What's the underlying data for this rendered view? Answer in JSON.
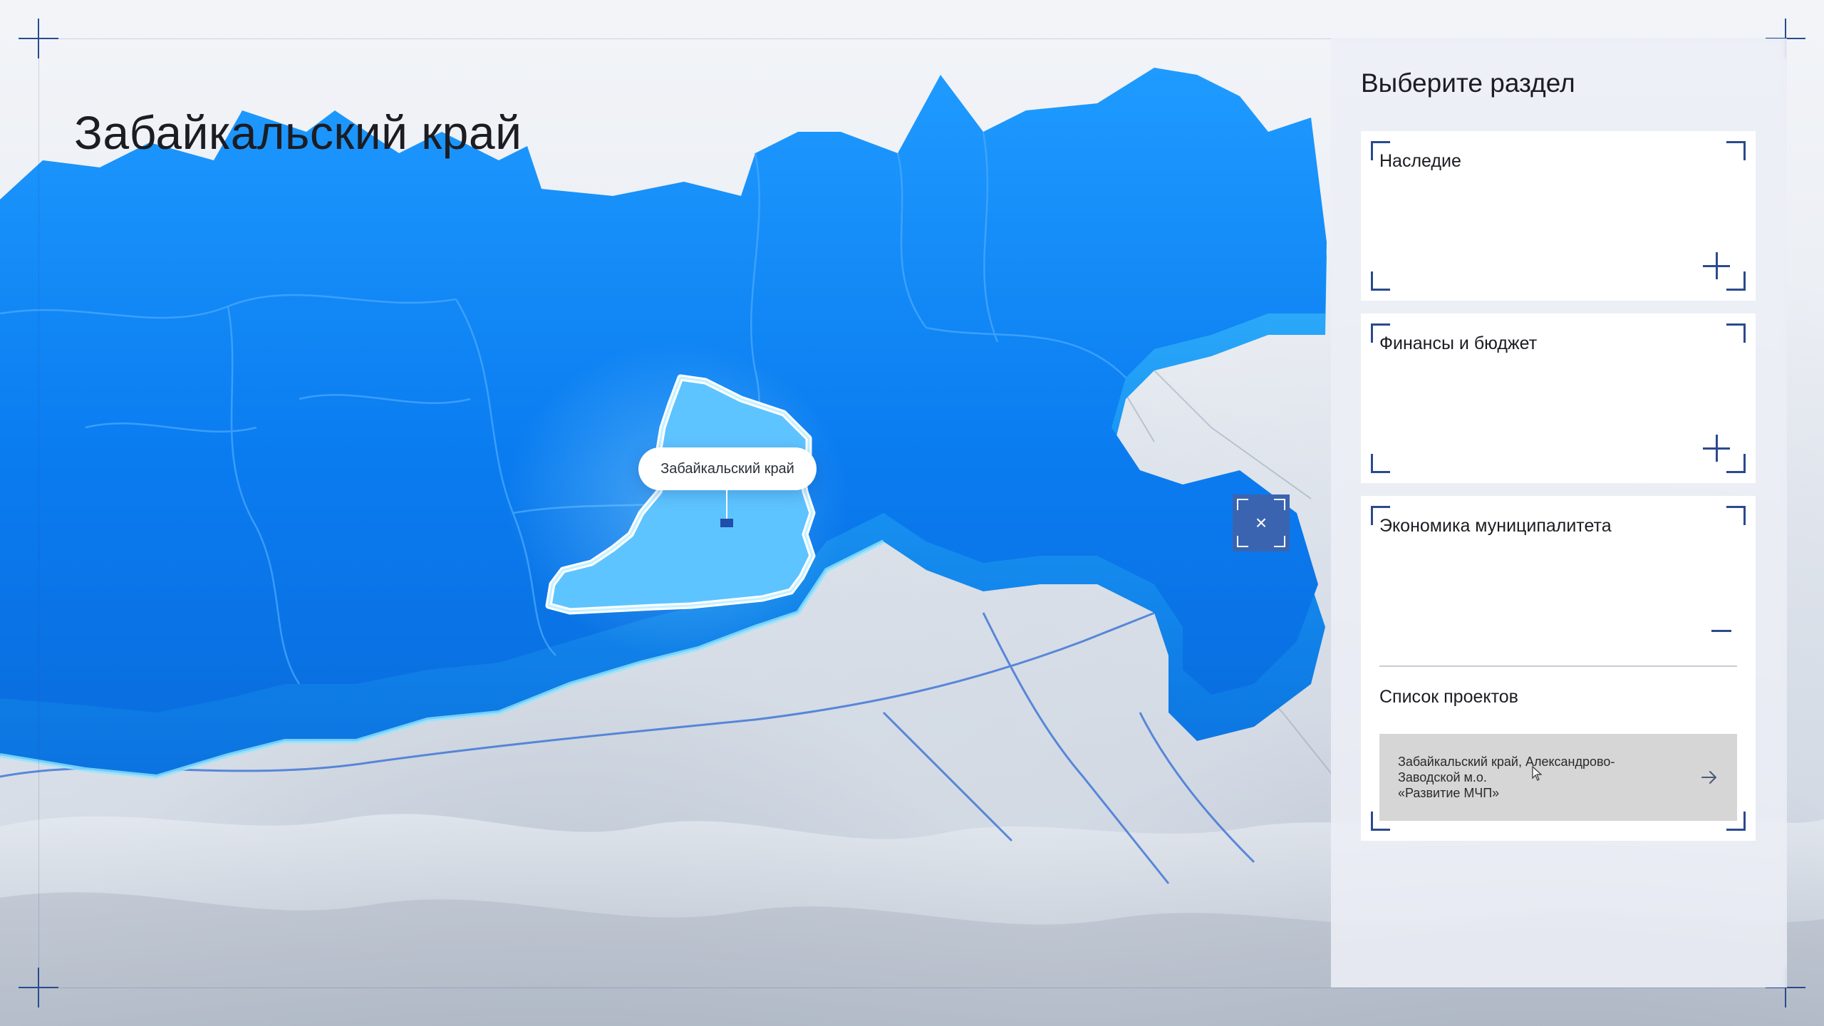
{
  "title": "Забайкальский край",
  "map": {
    "callout_label": "Забайкальский край",
    "close_label": "×"
  },
  "panel": {
    "heading": "Выберите раздел",
    "sections": [
      {
        "label": "Наследие",
        "state": "collapsed"
      },
      {
        "label": "Финансы и бюджет",
        "state": "collapsed"
      },
      {
        "label": "Экономика муниципалитета",
        "state": "expanded",
        "projects_heading": "Список проектов",
        "projects": [
          {
            "line1": "Забайкальский край, Александрово-",
            "line2": "Заводской м.о.",
            "line3": "«Развитие МЧП»"
          }
        ]
      }
    ]
  },
  "icons": {
    "expand": "plus-icon",
    "collapse": "minus-icon",
    "open_project": "arrow-right-icon",
    "close_map": "close-icon",
    "frame_corners": "crosshair-icon"
  },
  "colors": {
    "accent": "#2b4a8e",
    "map_blue": "#1a8fff",
    "map_blue_light": "#6fd0ff",
    "highlight_outline": "#ffffff",
    "button_blue": "#3b64b0",
    "project_bg": "#d6d6d6"
  }
}
